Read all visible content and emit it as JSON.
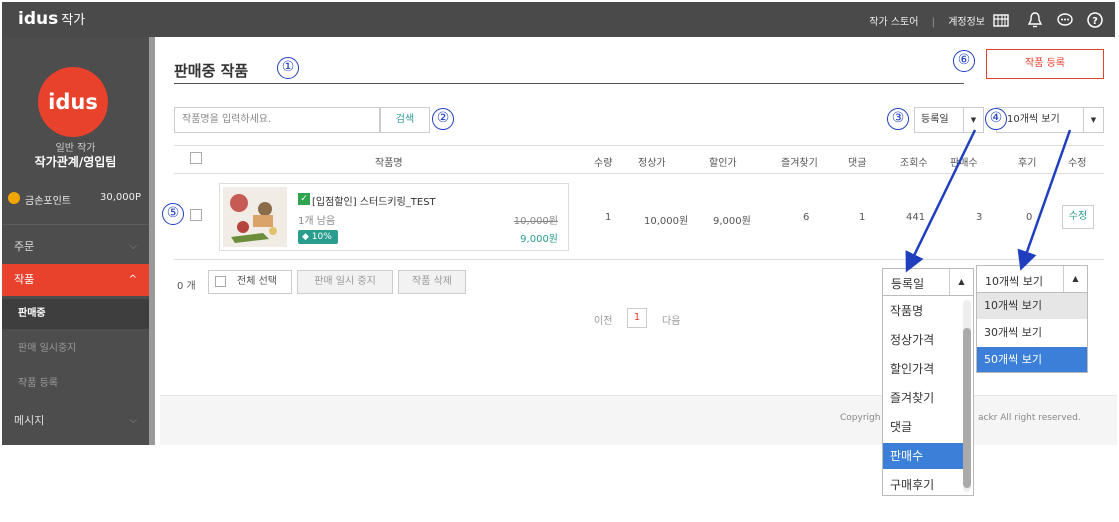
{
  "topbar": {
    "logo": "idus",
    "logo_sub": "작가",
    "links": [
      "작가 스토어",
      "계정정보"
    ],
    "separator": "|",
    "icons": [
      "shop-icon",
      "bell-icon",
      "chat-icon",
      "help-icon"
    ]
  },
  "sidebar": {
    "brand_logo": "idus",
    "role": "일반 작가",
    "team": "작가관계/영입팀",
    "points_label": "금손포인트",
    "points_value": "30,000P",
    "menu": {
      "order": "주문",
      "product": "작품",
      "message": "메시지"
    },
    "product_sub": [
      "판매중",
      "판매 일시중지",
      "작품 등록"
    ]
  },
  "main": {
    "page_title": "판매중 작품",
    "register_button": "작품 등록",
    "search_placeholder": "작품명을 입력하세요.",
    "search_button": "검색",
    "sort_selected": "등록일",
    "perpage_selected": "10개씩 보기",
    "columns": [
      "작품명",
      "수량",
      "정상가",
      "할인가",
      "즐겨찾기",
      "댓글",
      "조회수",
      "판매수",
      "후기",
      "수정"
    ],
    "product": {
      "name": "[입점할인] 스터드키링_TEST",
      "remaining": "1개 남음",
      "discount_badge": "10%",
      "orig_price": "10,000원",
      "sale_price": "9,000원",
      "qty": "1",
      "normal_price": "10,000원",
      "discount_price": "9,000원",
      "favorites": "6",
      "comments": "1",
      "views": "441",
      "sales": "3",
      "reviews": "0",
      "edit": "수정"
    },
    "count": "0 개",
    "select_all": "전체 선택",
    "pause_button": "판매 일시 중지",
    "delete_button": "작품 삭제",
    "pagination": {
      "prev": "이전",
      "page": "1",
      "next": "다음"
    },
    "footer_left": "Copyrigh",
    "footer_right": "ackr All right reserved."
  },
  "callouts": [
    "①",
    "②",
    "③",
    "④",
    "⑤",
    "⑥"
  ],
  "sort_dropdown": {
    "selected": "등록일",
    "options": [
      "작품명",
      "정상가격",
      "할인가격",
      "즐겨찾기",
      "댓글",
      "판매수",
      "구매후기"
    ],
    "highlighted": "판매수"
  },
  "perpage_dropdown": {
    "selected": "10개씩 보기",
    "options": [
      "10개씩 보기",
      "30개씩 보기",
      "50개씩 보기"
    ],
    "highlighted": "50개씩 보기"
  },
  "colors": {
    "topbar": "#4a4a4a",
    "sidebar": "#4d4d4d",
    "brand": "#e8412c",
    "accent_green": "#2a9d8f",
    "annotation": "#1f3fbf",
    "highlight": "#3c7fd8"
  }
}
